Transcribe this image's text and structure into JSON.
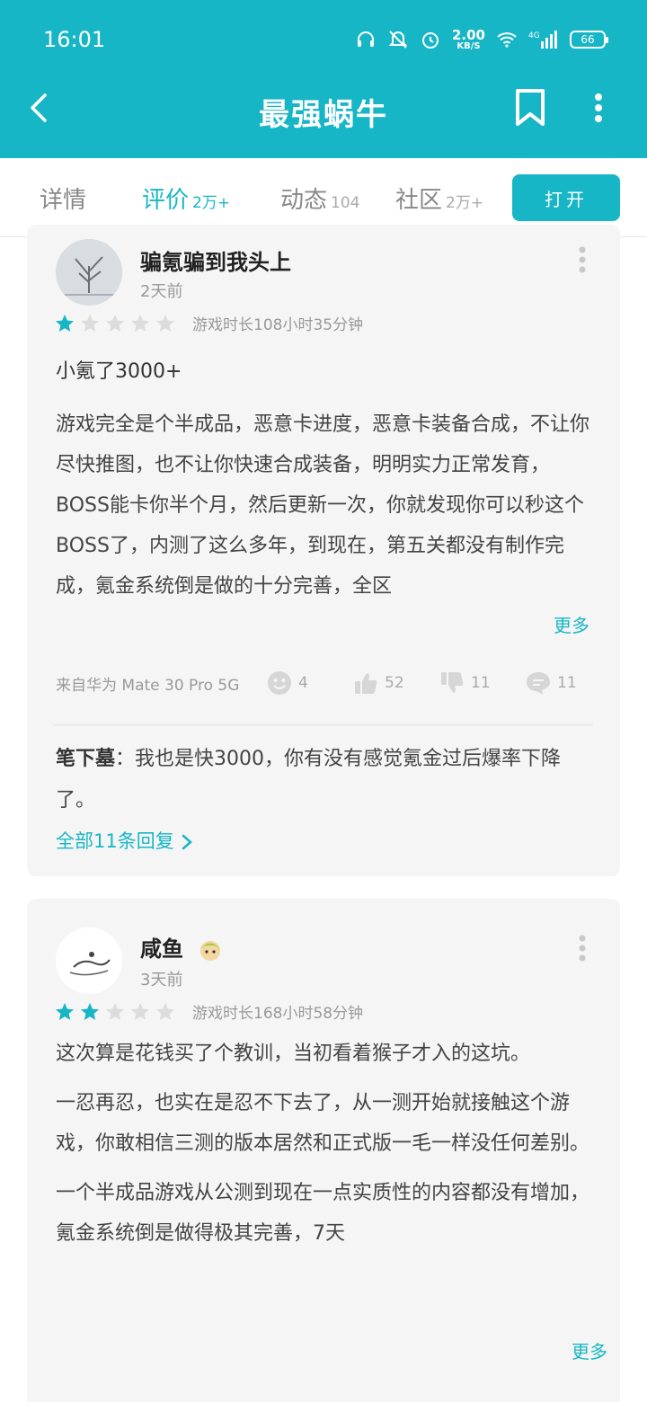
{
  "status": {
    "time": "16:01",
    "speed_value": "2.00",
    "speed_unit": "KB/S",
    "network": "4G",
    "battery": "66",
    "icons": [
      "headset-icon",
      "mute-icon",
      "alarm-icon",
      "wifi-icon",
      "signal-icon",
      "battery-icon"
    ]
  },
  "appbar": {
    "title": "最强蜗牛",
    "icons": [
      "back-arrow-icon",
      "bookmark-icon",
      "more-vertical-icon"
    ]
  },
  "tabs": [
    {
      "label": "详情",
      "count": ""
    },
    {
      "label": "评价",
      "count": "2万+"
    },
    {
      "label": "动态",
      "count": "104"
    },
    {
      "label": "社区",
      "count": "2万+"
    }
  ],
  "open_button": "打开",
  "colors": {
    "accent": "#17b6c6",
    "card_bg": "#f5f5f5",
    "star_off": "#dcdcdc"
  },
  "reviews": [
    {
      "username": "骗氪骗到我头上",
      "date": "2天前",
      "rating": 1,
      "playtime": "游戏时长108小时35分钟",
      "headline": "小氪了3000+",
      "body": [
        "游戏完全是个半成品，恶意卡进度，恶意卡装备合成，不让你尽快推图，也不让你快速合成装备，明明实力正常发育，BOSS能卡你半个月，然后更新一次，你就发现你可以秒这个BOSS了，内测了这么多年，到现在，第五关都没有制作完成，氪金系统倒是做的十分完善，全区"
      ],
      "more": "更多",
      "device": "来自华为 Mate 30 Pro 5G",
      "funny": "4",
      "likes": "52",
      "dislikes": "11",
      "comments": "11",
      "reply_author": "笔下墓",
      "reply_text": "：我也是快3000，你有没有感觉氪金过后爆率下降了。",
      "all_replies": "全部11条回复"
    },
    {
      "username": "咸鱼",
      "date": "3天前",
      "rating": 2,
      "playtime": "游戏时长168小时58分钟",
      "headline": "这次算是花钱买了个教训，当初看着猴子才入的这坑。",
      "body": [
        "一忍再忍，也实在是忍不下去了，从一测开始就接触这个游戏，你敢相信三测的版本居然和正式版一毛一样没任何差别。",
        "一个半成品游戏从公测到现在一点实质性的内容都没有增加，氪金系统倒是做得极其完善，7天"
      ],
      "more": "更多"
    }
  ]
}
